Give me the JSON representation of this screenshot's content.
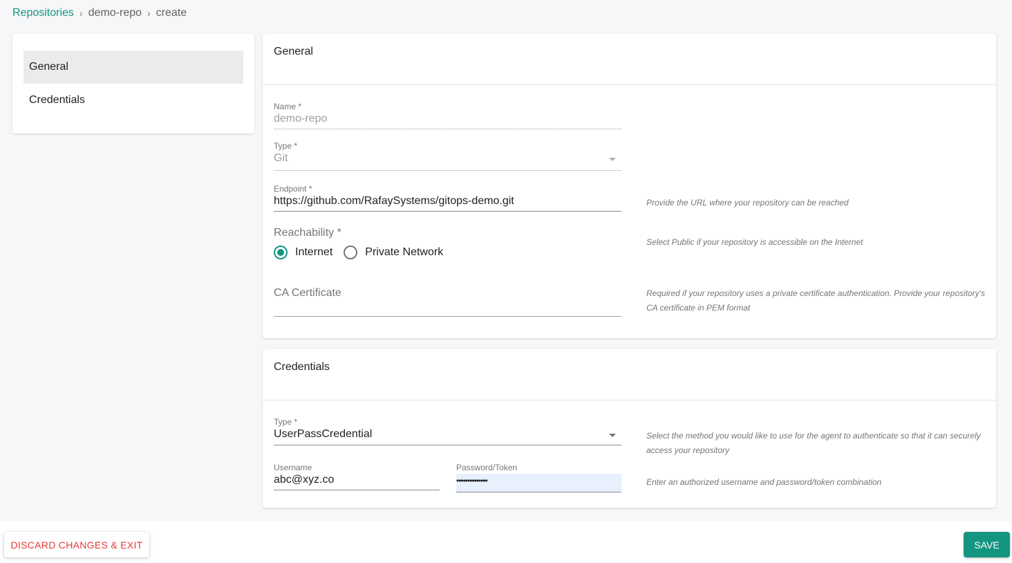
{
  "breadcrumb": {
    "items": [
      "Repositories",
      "demo-repo",
      "create"
    ],
    "separator": "›"
  },
  "sidebar": {
    "items": [
      {
        "label": "General",
        "active": true
      },
      {
        "label": "Credentials",
        "active": false
      }
    ]
  },
  "general": {
    "title": "General",
    "name": {
      "label": "Name *",
      "value": "demo-repo"
    },
    "type": {
      "label": "Type *",
      "value": "Git"
    },
    "endpoint": {
      "label": "Endpoint *",
      "value": "https://github.com/RafaySystems/gitops-demo.git",
      "help": "Provide the URL where your repository can be reached"
    },
    "reachability": {
      "label": "Reachability *",
      "options": [
        "Internet",
        "Private Network"
      ],
      "selected": "Internet",
      "help": "Select Public if your repository is accessible on the Internet"
    },
    "ca_certificate": {
      "label": "CA Certificate",
      "value": "",
      "help": "Required if your repository uses a private certificate authentication. Provide your repository's CA certificate in PEM format"
    }
  },
  "credentials": {
    "title": "Credentials",
    "type": {
      "label": "Type *",
      "value": "UserPassCredential",
      "help": "Select the method you would like to use for the agent to authenticate so that it can securely access your repository"
    },
    "username": {
      "label": "Username",
      "value": "abc@xyz.co"
    },
    "password": {
      "label": "Password/Token",
      "value": "••••••••••••••"
    },
    "help": "Enter an authorized username and password/token combination"
  },
  "footer": {
    "discard_label": "DISCARD CHANGES & EXIT",
    "save_label": "SAVE"
  },
  "colors": {
    "accent": "#14957f",
    "danger": "#e53935",
    "autofill": "#e8f0fe"
  }
}
